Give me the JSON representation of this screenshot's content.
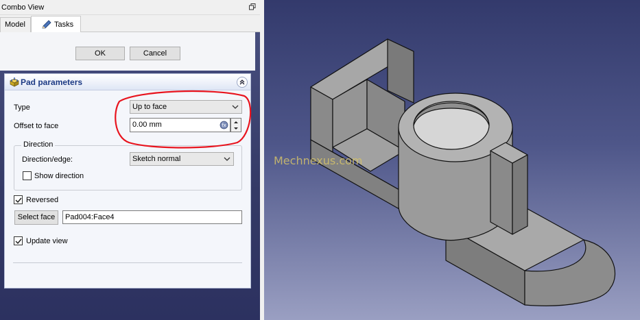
{
  "combo_view": {
    "title": "Combo View",
    "tabs": [
      {
        "label": "Model"
      },
      {
        "label": "Tasks"
      }
    ]
  },
  "task_buttons": {
    "ok_label": "OK",
    "cancel_label": "Cancel"
  },
  "pad_parameters": {
    "title": "Pad parameters",
    "type_label": "Type",
    "type_value": "Up to face",
    "offset_label": "Offset to face",
    "offset_value": "0.00 mm",
    "direction_group_title": "Direction",
    "direction_edge_label": "Direction/edge:",
    "direction_edge_value": "Sketch normal",
    "show_direction_label": "Show direction",
    "show_direction_checked": false,
    "reversed_label": "Reversed",
    "reversed_checked": true,
    "select_face_label": "Select face",
    "face_value": "Pad004:Face4",
    "update_view_label": "Update view",
    "update_view_checked": true
  },
  "viewer": {
    "watermark": "Mechnexus.com"
  },
  "colors": {
    "highlight_ellipse": "#e8141e",
    "header_title": "#1c3a84",
    "part_face_top": "#a7a7a7",
    "part_face_side": "#8a8a8a",
    "viewer_top": "#333a6c",
    "viewer_bottom": "#9a9fc2"
  }
}
